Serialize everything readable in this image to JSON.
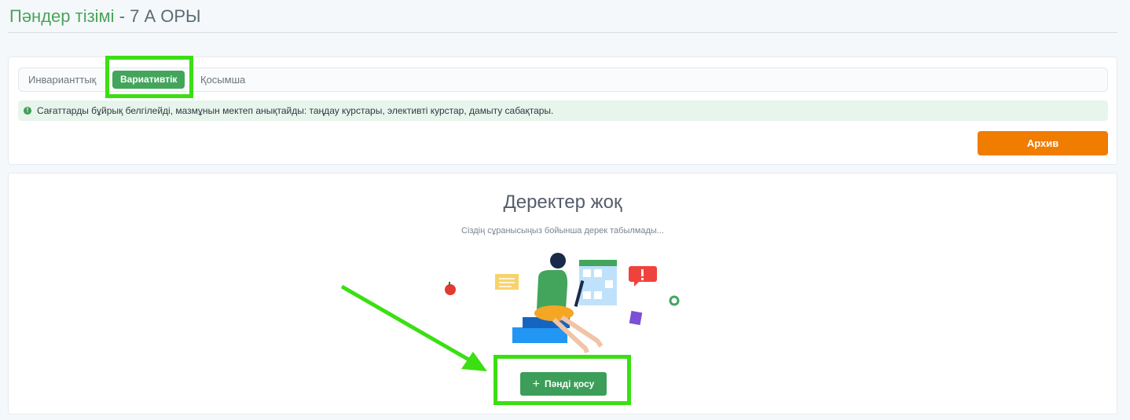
{
  "header": {
    "title": "Пәндер тізімі",
    "separator": " - ",
    "class_name": "7 А ОРЫ"
  },
  "tabs": [
    {
      "label": "Инварианттық",
      "active": false
    },
    {
      "label": "Вариативтік",
      "active": true
    },
    {
      "label": "Қосымша",
      "active": false
    }
  ],
  "alert": {
    "icon": "info-icon",
    "text": "Сағаттарды бұйрық белгілейді, мазмұнын мектеп анықтайды: таңдау курстары, элективті курстар, дамыту сабақтары."
  },
  "actions": {
    "archive_label": "Архив"
  },
  "empty_state": {
    "title": "Деректер жоқ",
    "subtitle": "Сіздің сұранысыңыз бойынша дерек табылмады...",
    "illustration": "person-with-laptop-illustration",
    "add_button_label": "Пәнді қосу",
    "add_icon": "plus-icon"
  },
  "colors": {
    "accent": "#43a55b",
    "archive": "#f07c00",
    "highlight": "#3bdf12"
  }
}
